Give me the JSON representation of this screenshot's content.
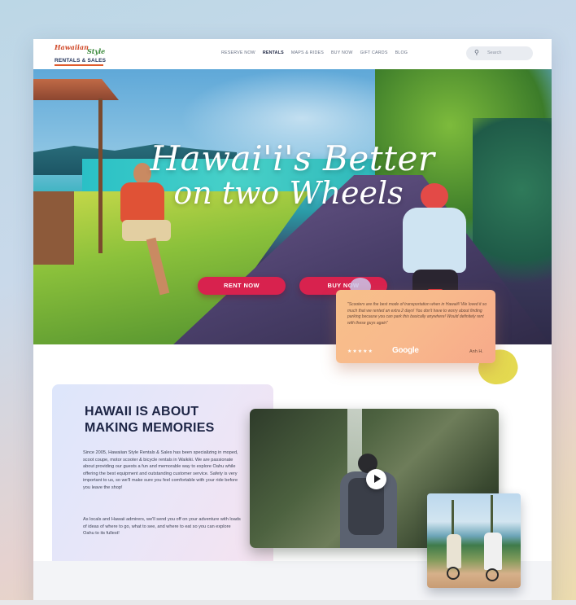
{
  "brand": {
    "script_line_1": "Hawaiian",
    "script_line_2": "Style",
    "line": "RENTALS & SALES"
  },
  "nav": {
    "items": [
      {
        "label": "RESERVE NOW",
        "active": false
      },
      {
        "label": "RENTALS",
        "active": true
      },
      {
        "label": "MAPS & RIDES",
        "active": false
      },
      {
        "label": "BUY NOW",
        "active": false
      },
      {
        "label": "GIFT CARDS",
        "active": false
      },
      {
        "label": "BLOG",
        "active": false
      }
    ],
    "search_placeholder": "Search",
    "search_icon": "search-icon"
  },
  "hero": {
    "headline_line_1": "Hawai'i's Better",
    "headline_line_2": "on two Wheels",
    "rent_button": "RENT NOW",
    "buy_button": "BUY NOW",
    "scroll_icon": "double-chevron-down-icon"
  },
  "review": {
    "quote": "\"Scooters are the best mode of transportation when in Hawaii!! We loved it so much that we rented an extra 2 days! You don't have to worry about finding parking because you can park this basically anywhere! Would definitely rent with these guys again\"",
    "stars": "★★★★★",
    "rating": 5,
    "source": "Google",
    "author": "Anh H."
  },
  "about": {
    "heading": "HAWAII IS ABOUT MAKING MEMORIES",
    "paragraph_1": "Since 2005, Hawaiian Style Rentals & Sales has been specializing in moped, scoot coupe, motor scooter & bicycle rentals in Waikiki. We are passionate about providing our guests a fun and memorable way to explore Oahu while offering the best equipment and outstanding customer service. Safety is very important to us, so we'll make sure you feel comfortable with your ride before you leave the shop!",
    "paragraph_2": "As locals and Hawaii admirers, we'll send you off on your adventure with loads of ideas of where to go, what to see, and where to eat so you can explore Oahu to its fullest!"
  },
  "media": {
    "video_icon": "play-icon",
    "colors": {
      "accent": "#d8224e",
      "heading": "#1d2545",
      "review_card": "#f8b98c"
    }
  }
}
